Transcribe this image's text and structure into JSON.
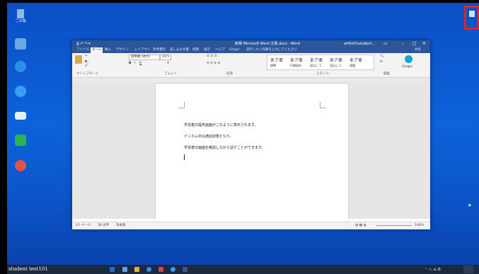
{
  "desktop": {
    "icons": [
      {
        "label": "ごみ箱",
        "color": "#8fb8e8"
      },
      {
        "label": "",
        "color": "#6ea8e0"
      },
      {
        "label": "",
        "color": "#2f8fe6"
      },
      {
        "label": "",
        "color": "#3a9ef0"
      },
      {
        "label": "",
        "color": "#e6eef8"
      },
      {
        "label": "",
        "color": "#2fb24a"
      },
      {
        "label": "",
        "color": "#e0534a"
      }
    ]
  },
  "word": {
    "title": "新規 Microsoft Word 文書.docx - Word",
    "account": "ahfkk01student...",
    "tabs": [
      "ファイル",
      "ホーム",
      "挿入",
      "デザイン",
      "レイアウト",
      "参考資料",
      "差し込み文書",
      "校閲",
      "表示",
      "ヘルプ",
      "Ginger",
      "実行したい作業を入力してください"
    ],
    "share_label": "共有",
    "clipboard_label": "クリップボード",
    "font_label": "フォント",
    "paragraph_label": "段落",
    "styles_label": "スタイル",
    "edit_label": "編集",
    "font_name": "游明朝 (本文)",
    "font_size": "10.5",
    "styles": [
      "あア亜",
      "あア亜",
      "あア亜",
      "あア亜",
      "あア亜"
    ],
    "style_names": [
      "標準",
      "行間詰め",
      "見出し 1",
      "見出し 2",
      "表題"
    ],
    "ginger_label": "Ginger",
    "doc_lines": [
      "学習者の提供画面がこのように表示されます。",
      "インカム中は通話状態となり、",
      "学習者の画面を確認しながら話すことができます。"
    ],
    "status": [
      "1/1 ページ",
      "58 文字",
      "日本語"
    ],
    "zoom": "100%"
  },
  "taskbar": {
    "user_label": "student test101"
  }
}
